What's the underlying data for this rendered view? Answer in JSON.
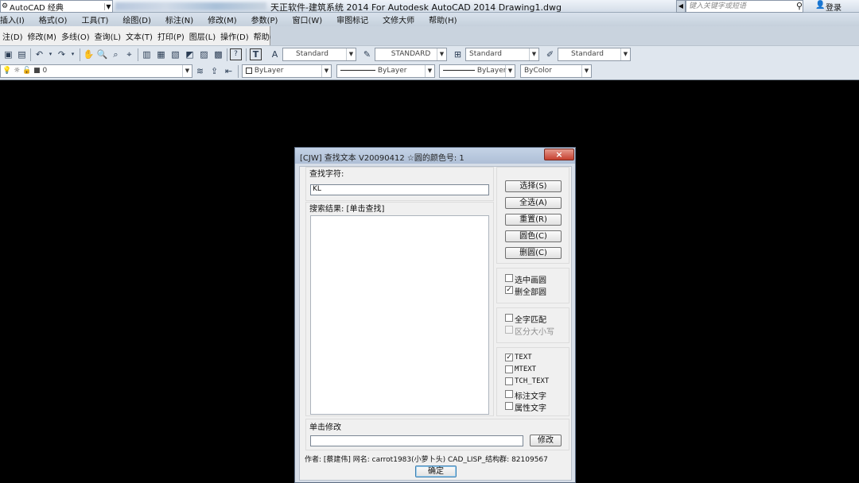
{
  "titlebar": {
    "workspace": "AutoCAD 经典",
    "title": "天正软件-建筑系统 2014  For Autodesk AutoCAD 2014    Drawing1.dwg",
    "search_placeholder": "键入关键字或短语",
    "login": "登录"
  },
  "menu1": [
    "插入(I)",
    "格式(O)",
    "工具(T)",
    "绘图(D)",
    "标注(N)",
    "修改(M)",
    "参数(P)",
    "窗口(W)",
    "审图标记",
    "文修大师",
    "帮助(H)"
  ],
  "menu2": [
    "注(D)",
    "修改(M)",
    "多线(O)",
    "查询(L)",
    "文本(T)",
    "打印(P)",
    "图层(L)",
    "操作(D)",
    "帮助(H)"
  ],
  "toolbar1": {
    "text_style": "Standard",
    "dim_style": "STANDARD",
    "table_style": "Standard",
    "mleader_style": "Standard"
  },
  "toolbar2": {
    "layer": "0",
    "color": "ByLayer",
    "linetype": "ByLayer",
    "lineweight": "ByLayer",
    "plotstyle": "ByColor"
  },
  "dialog": {
    "title": "[CJW] 查找文本 V20090412  ☆圆的颜色号: 1",
    "close": "×",
    "find_label": "查找字符:",
    "find_value": "KL",
    "results_label": "搜索结果: [单击查找]",
    "buttons": {
      "select": "选择(S)",
      "select_all": "全选(A)",
      "reset": "重置(R)",
      "circle_color": "圆色(C)",
      "delete_circle": "删圆(C)"
    },
    "options_circle": [
      {
        "label": "选中画圆",
        "checked": false,
        "disabled": false
      },
      {
        "label": "删全部圆",
        "checked": true,
        "disabled": false
      }
    ],
    "options_match": [
      {
        "label": "全字匹配",
        "checked": false,
        "disabled": false
      },
      {
        "label": "区分大小写",
        "checked": false,
        "disabled": true
      }
    ],
    "options_types": [
      {
        "label": "TEXT",
        "checked": true
      },
      {
        "label": "MTEXT",
        "checked": false
      },
      {
        "label": "TCH_TEXT",
        "checked": false
      },
      {
        "label": "标注文字",
        "checked": false
      },
      {
        "label": "属性文字",
        "checked": false
      }
    ],
    "modify_label": "单击修改",
    "modify_value": "",
    "modify_button": "修改",
    "footer": "作者: [蔡建伟]  网名: carrot1983(小萝卜头)  CAD_LISP_结构群: 82109567",
    "ok_button": "确定"
  }
}
